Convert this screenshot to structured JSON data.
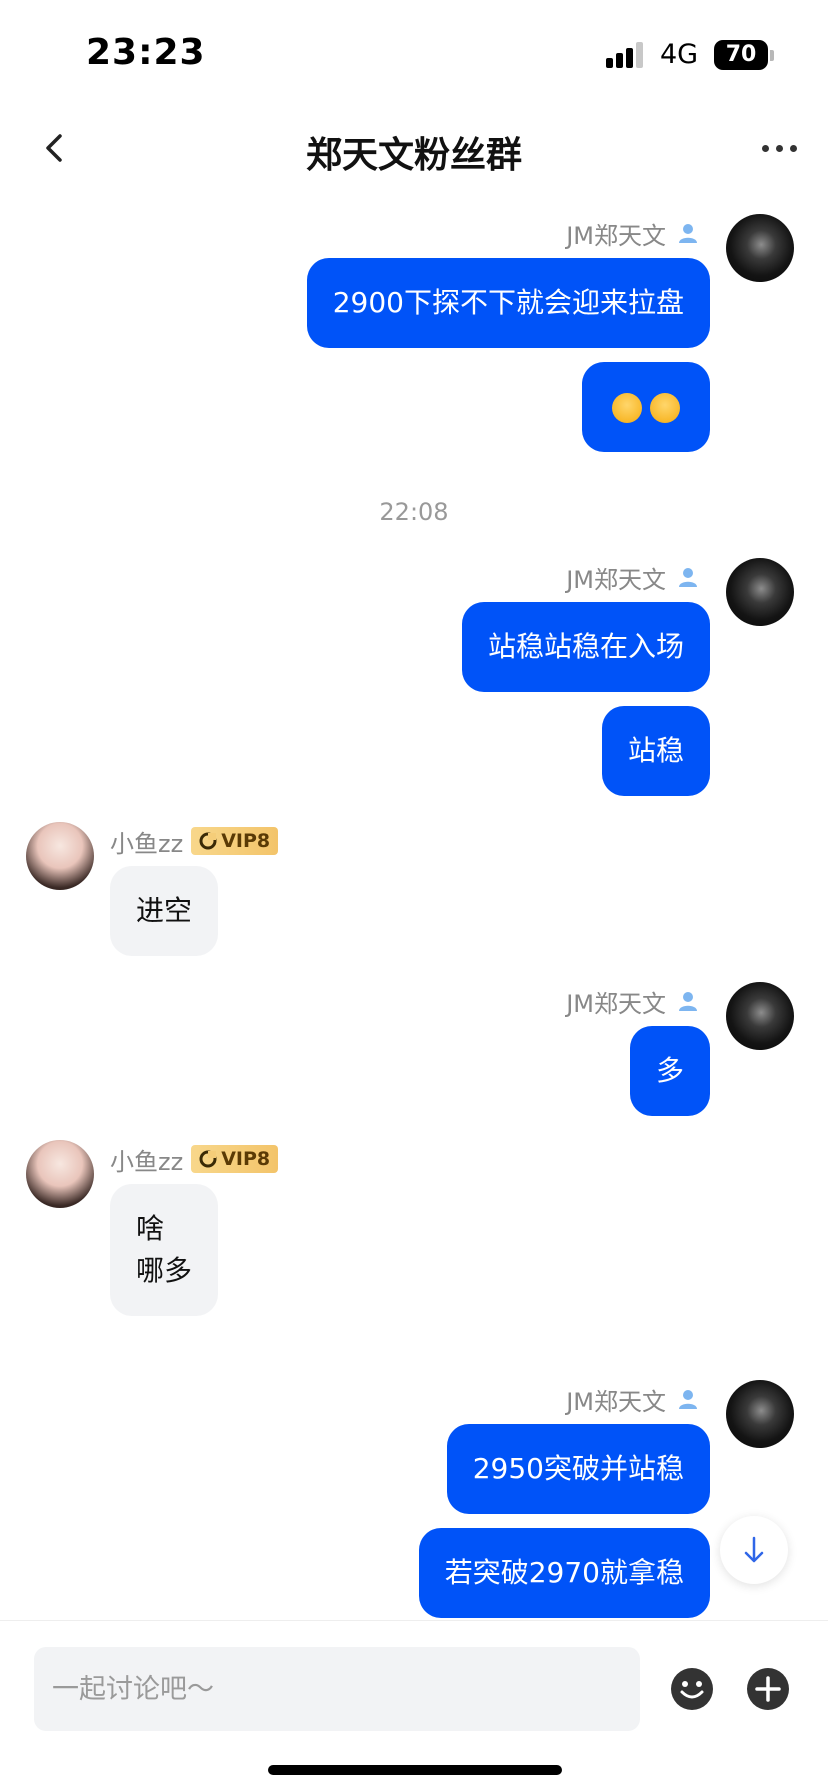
{
  "status_bar": {
    "time": "23:23",
    "network": "4G",
    "battery": "70"
  },
  "header": {
    "title": "郑天文粉丝群"
  },
  "messages": [
    {
      "sender": "JM郑天文",
      "text": "2900下探不下就会迎来拉盘"
    },
    {
      "emoji": [
        "shushing-face-emoji",
        "shushing-face-emoji"
      ]
    },
    {
      "time": "22:08"
    },
    {
      "sender": "JM郑天文",
      "text": "站稳站稳在入场"
    },
    {
      "text": "站稳"
    },
    {
      "sender": "小鱼zz",
      "badge": "VIP8",
      "text": "进空"
    },
    {
      "sender": "JM郑天文",
      "text": "多"
    },
    {
      "sender": "小鱼zz",
      "badge": "VIP8",
      "lines": [
        "啥",
        "哪多"
      ]
    },
    {
      "sender": "JM郑天文",
      "text": "2950突破并站稳"
    },
    {
      "text": "若突破2970就拿稳"
    }
  ],
  "composer": {
    "placeholder": "一起讨论吧～"
  },
  "colors": {
    "bubble_self": "#0053f8",
    "bubble_other": "#f2f3f5",
    "vip_gold": "#f3c46a"
  }
}
